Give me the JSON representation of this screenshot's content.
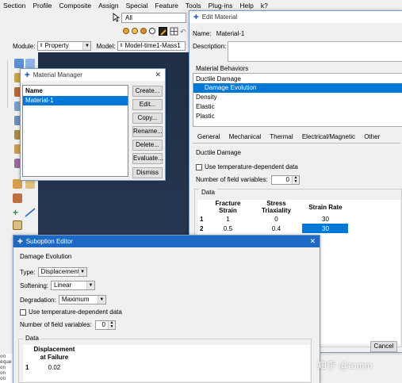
{
  "menubar": {
    "items": [
      "Section",
      "Profile",
      "Composite",
      "Assign",
      "Special",
      "Feature",
      "Tools",
      "Plug-ins",
      "Help",
      "k?"
    ]
  },
  "toolbar": {
    "select_filter_value": "All"
  },
  "modelbar": {
    "module_label": "Module:",
    "module_value": "Property",
    "model_label": "Model:",
    "model_value": "Model-time1-Mass1"
  },
  "message_area": {
    "lines": [
      "on",
      "eque",
      "on",
      "on",
      "on",
      "on",
      "on",
      "on"
    ]
  },
  "material_manager": {
    "title": "Material Manager",
    "list_header": "Name",
    "items": [
      "Material-1"
    ],
    "buttons": [
      "Create...",
      "Edit...",
      "Copy...",
      "Rename...",
      "Delete...",
      "Evaluate...",
      "Dismiss"
    ]
  },
  "edit_material": {
    "title": "Edit Material",
    "name_label": "Name:",
    "name_value": "Material-1",
    "description_label": "Description:",
    "behaviors_label": "Material Behaviors",
    "behaviors": [
      "Ductile Damage",
      "Damage Evolution",
      "Density",
      "Elastic",
      "Plastic"
    ],
    "selected_behavior_index": 1,
    "tabs": [
      "General",
      "Mechanical",
      "Thermal",
      "Electrical/Magnetic",
      "Other"
    ],
    "section_title": "Ductile Damage",
    "temp_dep_label": "Use temperature-dependent data",
    "field_vars_label": "Number of field variables:",
    "field_vars_value": "0",
    "data_label": "Data",
    "table_headers": [
      "Fracture Strain",
      "Stress Triaxiality",
      "Strain Rate"
    ],
    "table_rows": [
      {
        "index": "1",
        "cells": [
          "1",
          "0",
          "30"
        ]
      },
      {
        "index": "2",
        "cells": [
          "0.5",
          "0.4",
          "30"
        ]
      }
    ],
    "cancel_label": "Cancel"
  },
  "suboption_editor": {
    "title": "Suboption Editor",
    "section_title": "Damage Evolution",
    "type_label": "Type:",
    "type_value": "Displacement",
    "softening_label": "Softening:",
    "softening_value": "Linear",
    "degradation_label": "Degradation:",
    "degradation_value": "Maximum",
    "temp_dep_label": "Use temperature-dependent data",
    "field_vars_label": "Number of field variables:",
    "field_vars_value": "0",
    "data_label": "Data",
    "table_header_line1": "Displacement",
    "table_header_line2": "at Failure",
    "table_rows": [
      {
        "index": "1",
        "cells": [
          "0.02"
        ]
      }
    ]
  },
  "watermark": "知乎 @tomm",
  "colors": {
    "accent": "#0078d7",
    "titlebar_active": "#1d69c4",
    "viewport": "#24344e"
  }
}
